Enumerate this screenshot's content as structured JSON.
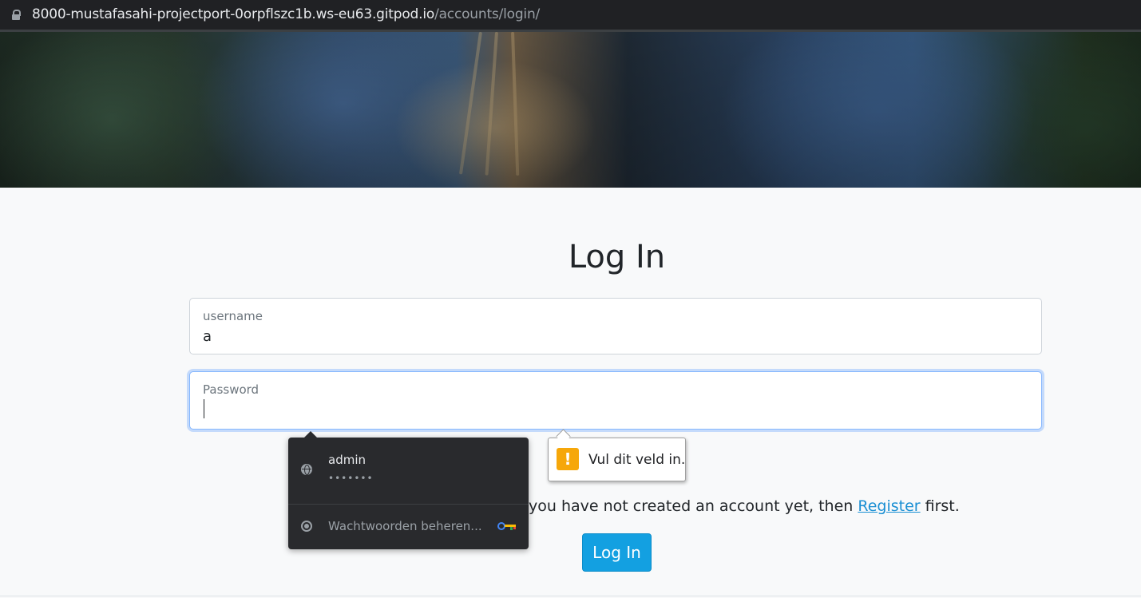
{
  "browser": {
    "url_host": "8000-mustafasahi-projectport-0orpflszc1b.ws-eu63.gitpod.io",
    "url_path": "/accounts/login/"
  },
  "page": {
    "title": "Log In",
    "username_label": "username",
    "username_value": "a",
    "password_label": "Password",
    "register_prefix": "you have not created an account yet, then ",
    "register_link": "Register",
    "register_suffix": " first.",
    "login_button": "Log In"
  },
  "password_popup": {
    "username": "admin",
    "password_mask": "•••••••",
    "manage_label": "Wachtwoorden beheren..."
  },
  "validation_tooltip": {
    "icon": "!",
    "text": "Vul dit veld in."
  },
  "colors": {
    "primary_button": "#13a0e1",
    "link": "#1a8fd3",
    "warning": "#f6a70a"
  }
}
